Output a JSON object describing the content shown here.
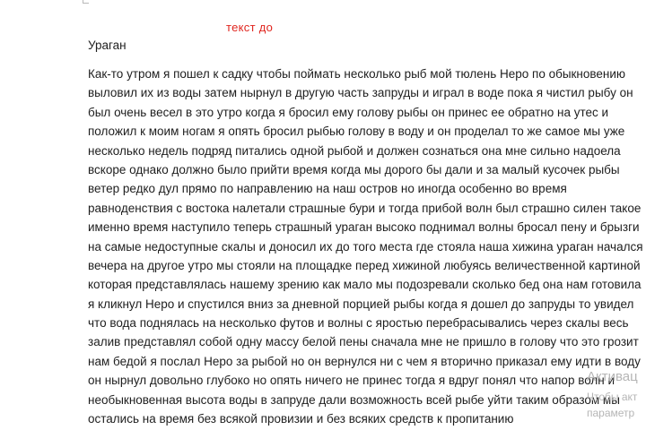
{
  "header": {
    "red_label": "текст до",
    "title": "Ураган"
  },
  "paragraph": {
    "lines": [
      "Как-то утром я пошел к садку чтобы поймать несколько рыб мой тюлень Неро по обыкновению",
      "выловил их из воды затем нырнул в другую часть запруды и играл в воде пока я чистил рыбу он",
      "был очень весел в это утро когда я бросил ему голову рыбы он принес ее обратно на утес и",
      "положил к моим ногам я опять бросил рыбью голову в воду и он проделал то же самое мы уже",
      "несколько недель подряд питались одной рыбой и должен сознаться она мне сильно надоела",
      "вскоре однако должно было прийти время когда мы дорого бы дали и за малый кусочек рыбы",
      "ветер редко дул прямо по направлению на наш остров но иногда особенно во время",
      "равноденствия с востока налетали страшные бури и тогда прибой волн был страшно силен такое",
      "именно время наступило теперь страшный ураган высоко поднимал волны бросал пену и брызги",
      "на самые недоступные скалы и доносил их до того места где стояла наша хижина ураган начался с",
      "вечера на другое утро мы стояли на площадке перед хижиной любуясь величественной картиной",
      "которая представлялась нашему зрению как мало мы подозревали сколько бед она нам готовила",
      "я кликнул Неро и спустился вниз за дневной порцией рыбы когда я дошел до запруды то увидел",
      "что вода поднялась на несколько футов и волны с яростью перебрасывались через скалы весь",
      "залив представлял собой одну массу белой пены сначала мне не пришло в голову что это грозит",
      "нам бедой я послал Неро за рыбой но он вернулся ни с чем я вторично приказал ему идти в воду",
      "он нырнул довольно глубоко но опять ничего не принес тогда я вдруг понял что напор волн и",
      "необыкновенная высота воды в запруде дали возможность всей рыбе уйти таким образом мы",
      "остались на время без всякой провизии и без всяких средств к пропитанию"
    ]
  },
  "watermark": {
    "title": "Активац",
    "line1": "Чтобы акт",
    "line2": "параметр"
  }
}
